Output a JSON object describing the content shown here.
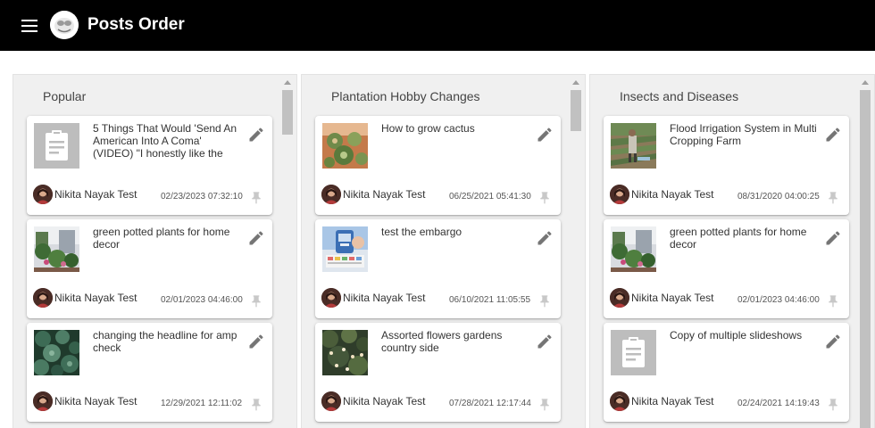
{
  "app": {
    "title": "Posts Order",
    "colors": {
      "appbar": "#000000",
      "column_bg": "#f0f0f0",
      "card_bg": "#ffffff",
      "icon": "#757575",
      "pin_icon": "#c8c8c8"
    }
  },
  "columns": [
    {
      "title": "Popular",
      "posts": [
        {
          "title": "5 Things That Would 'Send An American Into A Coma' (VIDEO) \"I honestly like the",
          "author": "Nikita Nayak Test",
          "date": "02/23/2023 07:32:10",
          "image": "clipboard-placeholder-icon"
        },
        {
          "title": "green potted plants for home decor",
          "author": "Nikita Nayak Test",
          "date": "02/01/2023 04:46:00",
          "image": "potted-plants-photo"
        },
        {
          "title": "changing the headline for amp check",
          "author": "Nikita Nayak Test",
          "date": "12/29/2021 12:11:02",
          "image": "succulents-photo"
        }
      ]
    },
    {
      "title": "Plantation Hobby Changes",
      "posts": [
        {
          "title": "How to grow cactus",
          "author": "Nikita Nayak Test",
          "date": "06/25/2021 05:41:30",
          "image": "cactus-photo"
        },
        {
          "title": "test the embargo",
          "author": "Nikita Nayak Test",
          "date": "06/10/2021 11:05:55",
          "image": "glucose-meter-photo"
        },
        {
          "title": "Assorted flowers gardens country side",
          "author": "Nikita Nayak Test",
          "date": "07/28/2021 12:17:44",
          "image": "flower-garden-photo"
        }
      ]
    },
    {
      "title": "Insects and Diseases",
      "posts": [
        {
          "title": "Flood Irrigation System in Multi Cropping Farm",
          "author": "Nikita Nayak Test",
          "date": "08/31/2020 04:00:25",
          "image": "farm-irrigation-photo"
        },
        {
          "title": "green potted plants for home decor",
          "author": "Nikita Nayak Test",
          "date": "02/01/2023 04:46:00",
          "image": "potted-plants-photo"
        },
        {
          "title": "Copy of multiple slideshows",
          "author": "Nikita Nayak Test",
          "date": "02/24/2021 14:19:43",
          "image": "clipboard-placeholder-icon"
        }
      ]
    }
  ]
}
